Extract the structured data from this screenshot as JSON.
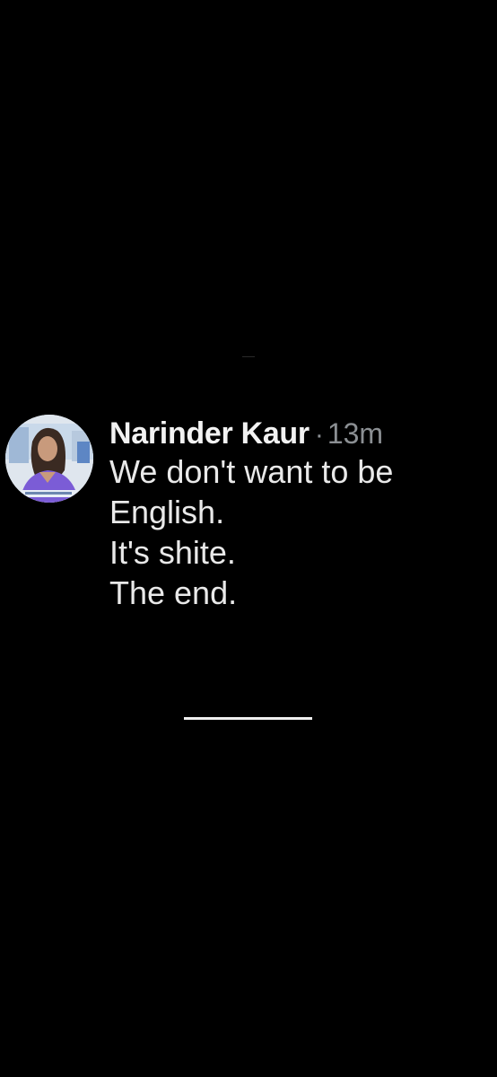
{
  "tweet": {
    "author_name": "Narinder Kaur",
    "separator": "·",
    "timestamp": "13m",
    "lines": [
      "We don't want to be",
      "English.",
      "It's shite.",
      "The end."
    ]
  },
  "colors": {
    "background": "#000000",
    "text": "#e7e9ea",
    "muted": "#8b8f93",
    "avatar_accent": "#7b5cd6"
  },
  "icons": {
    "avatar": "profile-photo"
  }
}
